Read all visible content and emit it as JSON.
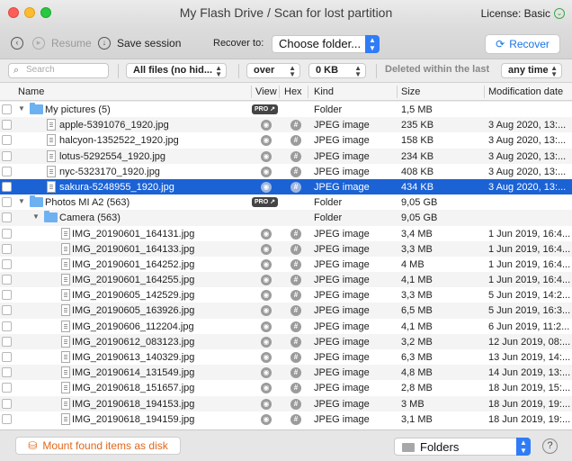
{
  "window": {
    "title": "My Flash Drive / Scan for lost partition",
    "license": "License: Basic"
  },
  "toolbar": {
    "resume": "Resume",
    "save_session": "Save session",
    "recover_to": "Recover to:",
    "choose_folder": "Choose folder...",
    "recover": "Recover"
  },
  "filters": {
    "search_placeholder": "Search",
    "file_filter": "All files (no hid...",
    "size_op": "over",
    "size_value": "0 KB",
    "deleted_label": "Deleted within the last",
    "time_value": "any time"
  },
  "columns": {
    "name": "Name",
    "view": "View",
    "hex": "Hex",
    "kind": "Kind",
    "size": "Size",
    "modified": "Modification date"
  },
  "badges": {
    "pro": "PRO ↗"
  },
  "rows": [
    {
      "type": "folder",
      "level": 0,
      "name": "My pictures (5)",
      "kind": "Folder",
      "size": "1,5 MB",
      "modified": "",
      "pro": true
    },
    {
      "type": "file",
      "level": 1,
      "name": "apple-5391076_1920.jpg",
      "kind": "JPEG image",
      "size": "235 KB",
      "modified": "3 Aug 2020, 13:..."
    },
    {
      "type": "file",
      "level": 1,
      "name": "halcyon-1352522_1920.jpg",
      "kind": "JPEG image",
      "size": "158 KB",
      "modified": "3 Aug 2020, 13:..."
    },
    {
      "type": "file",
      "level": 1,
      "name": "lotus-5292554_1920.jpg",
      "kind": "JPEG image",
      "size": "234 KB",
      "modified": "3 Aug 2020, 13:..."
    },
    {
      "type": "file",
      "level": 1,
      "name": "nyc-5323170_1920.jpg",
      "kind": "JPEG image",
      "size": "408 KB",
      "modified": "3 Aug 2020, 13:..."
    },
    {
      "type": "file",
      "level": 1,
      "name": "sakura-5248955_1920.jpg",
      "kind": "JPEG image",
      "size": "434 KB",
      "modified": "3 Aug 2020, 13:...",
      "selected": true
    },
    {
      "type": "folder",
      "level": 0,
      "name": "Photos MI A2 (563)",
      "kind": "Folder",
      "size": "9,05 GB",
      "modified": "",
      "pro": true
    },
    {
      "type": "folder",
      "level": 1,
      "name": "Camera (563)",
      "kind": "Folder",
      "size": "9,05 GB",
      "modified": ""
    },
    {
      "type": "file",
      "level": 2,
      "name": "IMG_20190601_164131.jpg",
      "kind": "JPEG image",
      "size": "3,4 MB",
      "modified": "1 Jun 2019, 16:4..."
    },
    {
      "type": "file",
      "level": 2,
      "name": "IMG_20190601_164133.jpg",
      "kind": "JPEG image",
      "size": "3,3 MB",
      "modified": "1 Jun 2019, 16:4..."
    },
    {
      "type": "file",
      "level": 2,
      "name": "IMG_20190601_164252.jpg",
      "kind": "JPEG image",
      "size": "4 MB",
      "modified": "1 Jun 2019, 16:4..."
    },
    {
      "type": "file",
      "level": 2,
      "name": "IMG_20190601_164255.jpg",
      "kind": "JPEG image",
      "size": "4,1 MB",
      "modified": "1 Jun 2019, 16:4..."
    },
    {
      "type": "file",
      "level": 2,
      "name": "IMG_20190605_142529.jpg",
      "kind": "JPEG image",
      "size": "3,3 MB",
      "modified": "5 Jun 2019, 14:2..."
    },
    {
      "type": "file",
      "level": 2,
      "name": "IMG_20190605_163926.jpg",
      "kind": "JPEG image",
      "size": "6,5 MB",
      "modified": "5 Jun 2019, 16:3..."
    },
    {
      "type": "file",
      "level": 2,
      "name": "IMG_20190606_112204.jpg",
      "kind": "JPEG image",
      "size": "4,1 MB",
      "modified": "6 Jun 2019, 11:2..."
    },
    {
      "type": "file",
      "level": 2,
      "name": "IMG_20190612_083123.jpg",
      "kind": "JPEG image",
      "size": "3,2 MB",
      "modified": "12 Jun 2019, 08:..."
    },
    {
      "type": "file",
      "level": 2,
      "name": "IMG_20190613_140329.jpg",
      "kind": "JPEG image",
      "size": "6,3 MB",
      "modified": "13 Jun 2019, 14:..."
    },
    {
      "type": "file",
      "level": 2,
      "name": "IMG_20190614_131549.jpg",
      "kind": "JPEG image",
      "size": "4,8 MB",
      "modified": "14 Jun 2019, 13:..."
    },
    {
      "type": "file",
      "level": 2,
      "name": "IMG_20190618_151657.jpg",
      "kind": "JPEG image",
      "size": "2,8 MB",
      "modified": "18 Jun 2019, 15:..."
    },
    {
      "type": "file",
      "level": 2,
      "name": "IMG_20190618_194153.jpg",
      "kind": "JPEG image",
      "size": "3 MB",
      "modified": "18 Jun 2019, 19:..."
    },
    {
      "type": "file",
      "level": 2,
      "name": "IMG_20190618_194159.jpg",
      "kind": "JPEG image",
      "size": "3,1 MB",
      "modified": "18 Jun 2019, 19:..."
    }
  ],
  "bottom": {
    "mount": "Mount found items as disk",
    "view_mode": "Folders",
    "help": "?"
  }
}
